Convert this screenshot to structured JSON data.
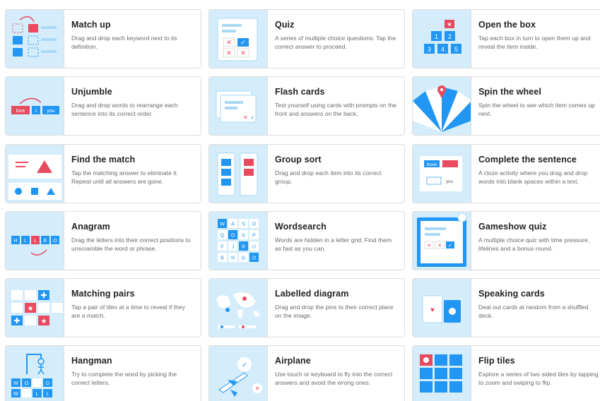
{
  "templates": [
    {
      "title": "Match up",
      "desc": "Drag and drop each keyword next to its definition.",
      "icon": "match-up-icon"
    },
    {
      "title": "Quiz",
      "desc": "A series of multiple choice questions. Tap the correct answer to proceed.",
      "icon": "quiz-icon"
    },
    {
      "title": "Open the box",
      "desc": "Tap each box in turn to open them up and reveal the item inside.",
      "icon": "open-the-box-icon",
      "box_numbers": [
        "1",
        "2",
        "3",
        "4",
        "5"
      ]
    },
    {
      "title": "Unjumble",
      "desc": "Drag and drop words to rearrange each sentence into its correct order.",
      "icon": "unjumble-icon",
      "words": [
        "love",
        "I",
        "you"
      ]
    },
    {
      "title": "Flash cards",
      "desc": "Test yourself using cards with prompts on the front and answers on the back.",
      "icon": "flash-cards-icon"
    },
    {
      "title": "Spin the wheel",
      "desc": "Spin the wheel to see which item comes up next.",
      "icon": "spin-the-wheel-icon"
    },
    {
      "title": "Find the match",
      "desc": "Tap the matching answer to eliminate it. Repeat until all answers are gone.",
      "icon": "find-the-match-icon"
    },
    {
      "title": "Group sort",
      "desc": "Drag and drop each item into its correct group.",
      "icon": "group-sort-icon"
    },
    {
      "title": "Complete the sentence",
      "desc": "A cloze activity where you drag and drop words into blank spaces within a text.",
      "icon": "complete-the-sentence-icon",
      "words": [
        "thank",
        "you"
      ]
    },
    {
      "title": "Anagram",
      "desc": "Drag the letters into their correct positions to unscramble the word or phrase.",
      "icon": "anagram-icon",
      "letters": [
        "H",
        "L",
        "L",
        "E",
        "O"
      ]
    },
    {
      "title": "Wordsearch",
      "desc": "Words are hidden in a letter grid. Find them as fast as you can.",
      "icon": "wordsearch-icon",
      "letters": [
        "W",
        "A",
        "S",
        "O",
        "Q",
        "O",
        "X",
        "P",
        "F",
        "J",
        "R",
        "U",
        "B",
        "N",
        "G",
        "D"
      ]
    },
    {
      "title": "Gameshow quiz",
      "desc": "A multiple choice quiz with time pressure, lifelines and a bonus round.",
      "icon": "gameshow-quiz-icon"
    },
    {
      "title": "Matching pairs",
      "desc": "Tap a pair of tiles at a time to reveal if they are a match.",
      "icon": "matching-pairs-icon"
    },
    {
      "title": "Labelled diagram",
      "desc": "Drag and drop the pins to their correct place on the image.",
      "icon": "labelled-diagram-icon"
    },
    {
      "title": "Speaking cards",
      "desc": "Deal out cards at random from a shuffled deck.",
      "icon": "speaking-cards-icon"
    },
    {
      "title": "Hangman",
      "desc": "Try to complete the word by picking the correct letters.",
      "icon": "hangman-icon",
      "letters": [
        "W",
        "O",
        "D",
        "W",
        "L",
        "L"
      ]
    },
    {
      "title": "Airplane",
      "desc": "Use touch or keyboard to fly into the correct answers and avoid the wrong ones.",
      "icon": "airplane-icon"
    },
    {
      "title": "Flip tiles",
      "desc": "Explore a series of two sided tiles by tapping to zoom and swiping to flip.",
      "icon": "flip-tiles-icon"
    }
  ],
  "colors": {
    "thumb_bg": "#d5edfb",
    "blue": "#2196f3",
    "red": "#e84a5f",
    "light_blue": "#a9d8f5"
  }
}
